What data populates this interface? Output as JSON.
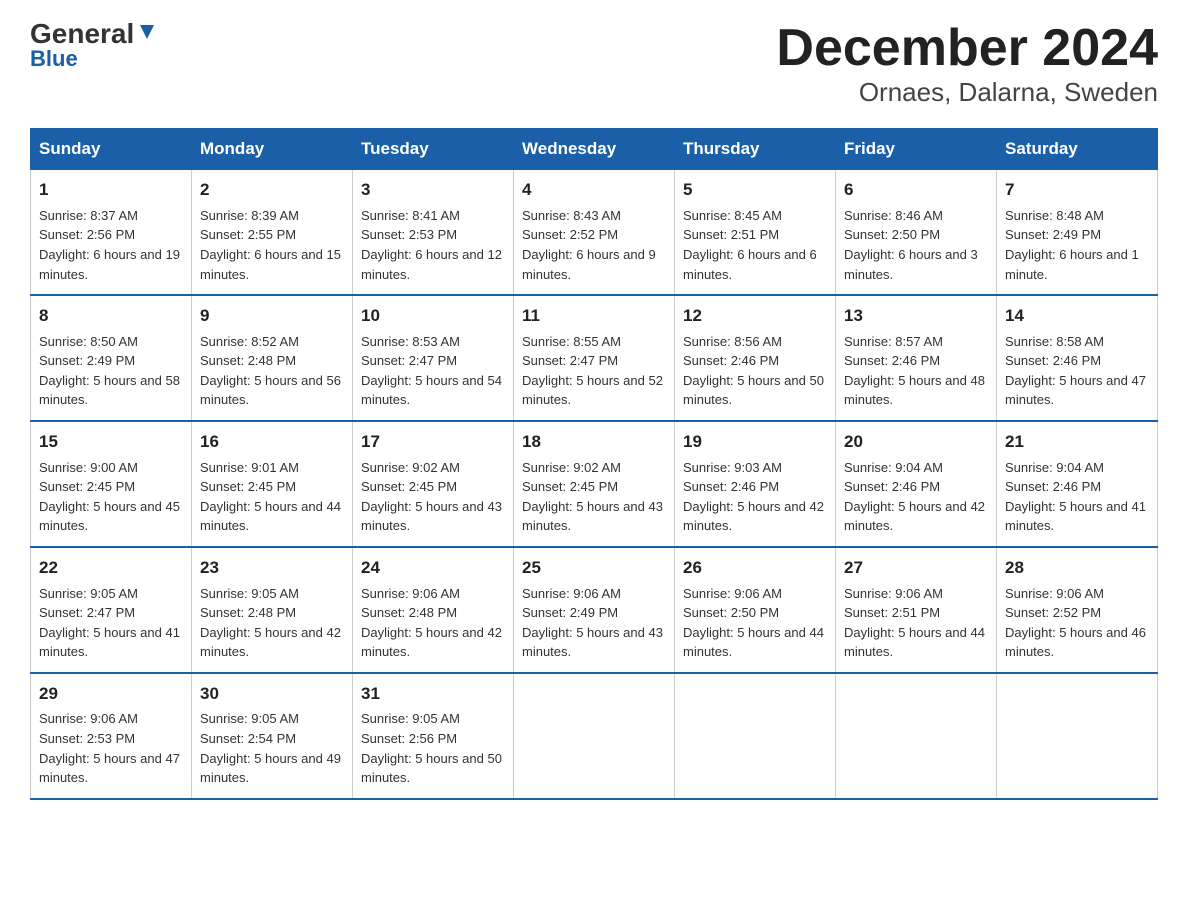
{
  "logo": {
    "general": "General",
    "blue": "Blue"
  },
  "title": "December 2024",
  "subtitle": "Ornaes, Dalarna, Sweden",
  "days_header": [
    "Sunday",
    "Monday",
    "Tuesday",
    "Wednesday",
    "Thursday",
    "Friday",
    "Saturday"
  ],
  "weeks": [
    [
      {
        "num": "1",
        "sunrise": "8:37 AM",
        "sunset": "2:56 PM",
        "daylight": "6 hours and 19 minutes."
      },
      {
        "num": "2",
        "sunrise": "8:39 AM",
        "sunset": "2:55 PM",
        "daylight": "6 hours and 15 minutes."
      },
      {
        "num": "3",
        "sunrise": "8:41 AM",
        "sunset": "2:53 PM",
        "daylight": "6 hours and 12 minutes."
      },
      {
        "num": "4",
        "sunrise": "8:43 AM",
        "sunset": "2:52 PM",
        "daylight": "6 hours and 9 minutes."
      },
      {
        "num": "5",
        "sunrise": "8:45 AM",
        "sunset": "2:51 PM",
        "daylight": "6 hours and 6 minutes."
      },
      {
        "num": "6",
        "sunrise": "8:46 AM",
        "sunset": "2:50 PM",
        "daylight": "6 hours and 3 minutes."
      },
      {
        "num": "7",
        "sunrise": "8:48 AM",
        "sunset": "2:49 PM",
        "daylight": "6 hours and 1 minute."
      }
    ],
    [
      {
        "num": "8",
        "sunrise": "8:50 AM",
        "sunset": "2:49 PM",
        "daylight": "5 hours and 58 minutes."
      },
      {
        "num": "9",
        "sunrise": "8:52 AM",
        "sunset": "2:48 PM",
        "daylight": "5 hours and 56 minutes."
      },
      {
        "num": "10",
        "sunrise": "8:53 AM",
        "sunset": "2:47 PM",
        "daylight": "5 hours and 54 minutes."
      },
      {
        "num": "11",
        "sunrise": "8:55 AM",
        "sunset": "2:47 PM",
        "daylight": "5 hours and 52 minutes."
      },
      {
        "num": "12",
        "sunrise": "8:56 AM",
        "sunset": "2:46 PM",
        "daylight": "5 hours and 50 minutes."
      },
      {
        "num": "13",
        "sunrise": "8:57 AM",
        "sunset": "2:46 PM",
        "daylight": "5 hours and 48 minutes."
      },
      {
        "num": "14",
        "sunrise": "8:58 AM",
        "sunset": "2:46 PM",
        "daylight": "5 hours and 47 minutes."
      }
    ],
    [
      {
        "num": "15",
        "sunrise": "9:00 AM",
        "sunset": "2:45 PM",
        "daylight": "5 hours and 45 minutes."
      },
      {
        "num": "16",
        "sunrise": "9:01 AM",
        "sunset": "2:45 PM",
        "daylight": "5 hours and 44 minutes."
      },
      {
        "num": "17",
        "sunrise": "9:02 AM",
        "sunset": "2:45 PM",
        "daylight": "5 hours and 43 minutes."
      },
      {
        "num": "18",
        "sunrise": "9:02 AM",
        "sunset": "2:45 PM",
        "daylight": "5 hours and 43 minutes."
      },
      {
        "num": "19",
        "sunrise": "9:03 AM",
        "sunset": "2:46 PM",
        "daylight": "5 hours and 42 minutes."
      },
      {
        "num": "20",
        "sunrise": "9:04 AM",
        "sunset": "2:46 PM",
        "daylight": "5 hours and 42 minutes."
      },
      {
        "num": "21",
        "sunrise": "9:04 AM",
        "sunset": "2:46 PM",
        "daylight": "5 hours and 41 minutes."
      }
    ],
    [
      {
        "num": "22",
        "sunrise": "9:05 AM",
        "sunset": "2:47 PM",
        "daylight": "5 hours and 41 minutes."
      },
      {
        "num": "23",
        "sunrise": "9:05 AM",
        "sunset": "2:48 PM",
        "daylight": "5 hours and 42 minutes."
      },
      {
        "num": "24",
        "sunrise": "9:06 AM",
        "sunset": "2:48 PM",
        "daylight": "5 hours and 42 minutes."
      },
      {
        "num": "25",
        "sunrise": "9:06 AM",
        "sunset": "2:49 PM",
        "daylight": "5 hours and 43 minutes."
      },
      {
        "num": "26",
        "sunrise": "9:06 AM",
        "sunset": "2:50 PM",
        "daylight": "5 hours and 44 minutes."
      },
      {
        "num": "27",
        "sunrise": "9:06 AM",
        "sunset": "2:51 PM",
        "daylight": "5 hours and 44 minutes."
      },
      {
        "num": "28",
        "sunrise": "9:06 AM",
        "sunset": "2:52 PM",
        "daylight": "5 hours and 46 minutes."
      }
    ],
    [
      {
        "num": "29",
        "sunrise": "9:06 AM",
        "sunset": "2:53 PM",
        "daylight": "5 hours and 47 minutes."
      },
      {
        "num": "30",
        "sunrise": "9:05 AM",
        "sunset": "2:54 PM",
        "daylight": "5 hours and 49 minutes."
      },
      {
        "num": "31",
        "sunrise": "9:05 AM",
        "sunset": "2:56 PM",
        "daylight": "5 hours and 50 minutes."
      },
      null,
      null,
      null,
      null
    ]
  ]
}
